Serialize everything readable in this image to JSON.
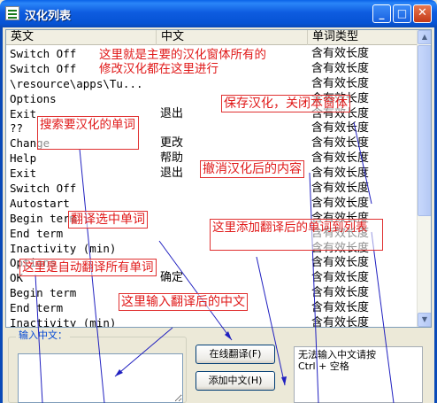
{
  "window": {
    "title": "汉化列表",
    "min_glyph": "_",
    "max_glyph": "□",
    "close_glyph": "✕"
  },
  "list": {
    "columns": [
      "英文",
      "中文",
      "单词类型"
    ],
    "rows": [
      {
        "en": "Switch Off",
        "zh": "",
        "type": "含有效长度"
      },
      {
        "en": "Switch Off",
        "zh": "",
        "type": "含有效长度"
      },
      {
        "en": "\\resource\\apps\\Tu...",
        "zh": "",
        "type": "含有效长度"
      },
      {
        "en": "Options",
        "zh": "",
        "type": "含有效长度"
      },
      {
        "en": "Exit",
        "zh": "退出",
        "type": "含有效长度"
      },
      {
        "en": "??",
        "zh": "",
        "type": "含有效长度"
      },
      {
        "en": "Change",
        "zh": "更改",
        "type": "含有效长度"
      },
      {
        "en": "Help",
        "zh": "帮助",
        "type": "含有效长度"
      },
      {
        "en": "Exit",
        "zh": "退出",
        "type": "含有效长度"
      },
      {
        "en": "Switch Off",
        "zh": "",
        "type": "含有效长度"
      },
      {
        "en": "Autostart",
        "zh": "",
        "type": "含有效长度"
      },
      {
        "en": "Begin term",
        "zh": "",
        "type": "含有效长度"
      },
      {
        "en": "End term",
        "zh": "",
        "type": "含有效长度"
      },
      {
        "en": "Inactivity (min)",
        "zh": "",
        "type": "含有效长度"
      },
      {
        "en": "Options",
        "zh": "",
        "type": "含有效长度"
      },
      {
        "en": "OK",
        "zh": "确定",
        "type": "含有效长度"
      },
      {
        "en": "Begin term",
        "zh": "",
        "type": "含有效长度"
      },
      {
        "en": "End term",
        "zh": "",
        "type": "含有效长度"
      },
      {
        "en": "Inactivity (min)",
        "zh": "",
        "type": "含有效长度"
      }
    ]
  },
  "input": {
    "group_label": "输入中文：",
    "value": ""
  },
  "buttons": {
    "online_translate": "在线翻译(F)",
    "add_chinese": "添加中文(H)"
  },
  "hint": {
    "line1": "无法输入中文请按",
    "line2": "Ctrl + 空格"
  },
  "annotations": {
    "main_window": "这里就是主要的汉化窗体所有的",
    "main_window_2": "修改汉化都在这里进行",
    "save": "保存汉化，关闭本窗体",
    "search": "搜索要汉化的单词",
    "undo": "撤消汉化后的内容",
    "translate_selected": "翻译选中单词",
    "add_to_list": "这里添加翻译后的单词到列表",
    "auto_translate": "这里是自动翻译所有单词",
    "input_here": "这里输入翻译后的中文"
  },
  "colors": {
    "annotation": "#e01818",
    "arrow": "#2020c0",
    "title_bar": "#0a5ce0"
  }
}
